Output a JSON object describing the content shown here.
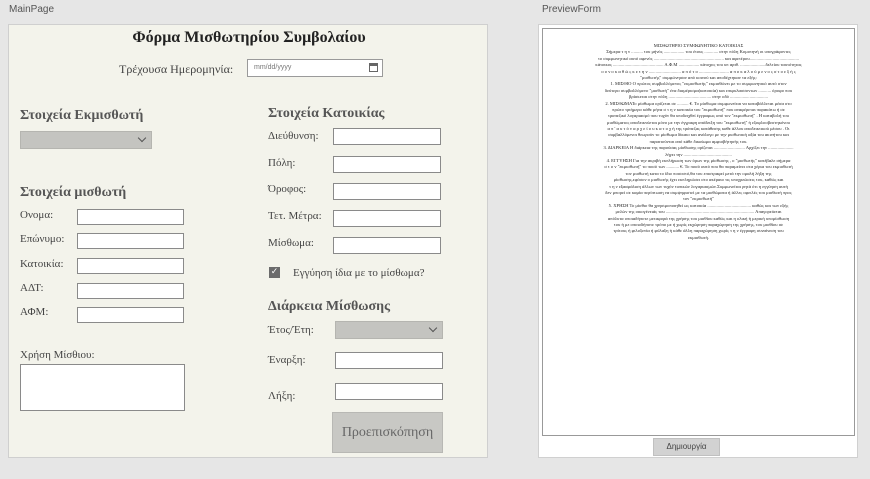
{
  "panes": {
    "main": "MainPage",
    "preview": "PreviewForm"
  },
  "form": {
    "title": "Φόρμα Μισθωτηρίου Συμβολαίου",
    "date_label": "Τρέχουσα Ημερομηνία:",
    "date_placeholder": "mm/dd/yyyy",
    "landlord_section": "Στοιχεία Εκμισθωτή",
    "tenant_section": "Στοιχεία μισθωτή",
    "tenant_fields": [
      "Ονομα:",
      "Επώνυμο:",
      "Κατοικία:",
      "ΑΔΤ:",
      "ΑΦΜ:"
    ],
    "use_label": "Χρήση Μίσθιου:",
    "property_section": "Στοιχεία  Κατοικίας",
    "property_fields": [
      "Διεύθυνση:",
      "Πόλη:",
      "Όροφος:",
      "Τετ. Μέτρα:",
      "Μίσθωμα:"
    ],
    "guarantee_label": "Εγγύηση ίδια με το μίσθωμα?",
    "guarantee_checked": true,
    "duration_section": "Διάρκεια Μίσθωσης",
    "duration_fields": [
      "Έτος/Έτη:",
      "Έναρξη:",
      "Λήξη:"
    ],
    "preview_button": "Προεπισκόπηση"
  },
  "preview": {
    "create_button": "Δημιουργία",
    "lines": [
      "ΜΙΣΘΩΤΗΡΙΟ ΣΥΜΦΩΝΗΤΙΚΟ ΚΑΤΟΙΚΙΑΣ",
      "Σήμερα τ η ν .......... του μήνός .................. του έτους ............ στην πόλη Κομοτηνή οι υπογράφοντες",
      "το συμφωνητικό αυτό αφενός ............................................................. και αφετέρου...........................................",
      "κάτοικος ............................................ Α.Φ.Μ .................. κάτοχος του υπ αριθ. ......................δελτίου ταυτότητας",
      "ο ο ν ο κ α θ ώ ς κ ε τ η ν ............................ α π ό τ ο .......................... α π ο κ α λ ο ύ μ ε ν ο ς σ τ ο ε ξ ή ς",
      "\"μισθωτής\" συμφώνησαν από κοινού και αποδέχτηκαν τα εξής:",
      "1. ΜΙΣΘΙΟ Ο πρώτος συμβαλλόμενος \"εκμισθωτής\" εκμισθώνει με το συμφωνητικό αυτό στον",
      "δεύτερο συμβαλλόμενο \"μισθωτή\" ένα διαμέρισμα(κατοικία) και επιφυλασσοντων ........... όροφο που",
      "βρίσκεται στην πόλη ..................................... στην οδό .................................",
      "2. ΜΙΣΘΩΜΑΤο μίσθωμα ορίζεται σε .......... €. Το μίσθωμα συμφωνείται να καταβάλλεται μέσα στο",
      "πρώτο τριήμερο κάθε μήνα σ τ η ν κατοικία του \"εκμισθωτή\" που αναφέρεται παρακάτω ή σε",
      "τραπεζικό λογαριασμό που τυχόν θα υποδειχθεί έγγραφως από τον \"εκμισθωτή\" . Η καταβολή του",
      "μισθώματος αποδεικνύεται μόνο με την έγγραφη απόδειξη του \"εκμισθωτή\" ή εξοφλοσβεστηκόνου",
      "α π ' α υ τ ό ν α ρ χ ε ί ο υ κ α τ ο χ ή της τράπεζας κατάθεσης καθε άλλου αποδεικτικού μέσου . Οι",
      "συμβαλλόμενοι θεωρούν το μίσθωμα δίκαιο και ανάλογο με την μισθωτική αξία του ακινήτου και",
      "παραιτούνται από κάθε δικαίωμα αμφισβήτησής του.",
      "3. ΔΙΑΡΚΕΙΑ Η διάρκεια της παρούσας μίσθωσης ορίζεται ........................... Αρχίζει την ......................",
      "λήγει την ..........................................",
      "4. ΕΓΓΥΗΣΗ Για την ακριβή εκπλήρωση των όρων της μίσθωσης , ο \"μισθωτής\" κατέβαλε σήμερα",
      "σ τ ο ν \"εκμισθωτή\" το ποσό των ........... €. Το ποσό αυτό που θα παραμείνει στα χέρια του εκμισθωτή",
      "τον μισθωτή κατα το ίδιο ποσοστό,θα του επιστραφεί μετά την ομαλή λήξη της",
      "μίσθωσης,εφόσον ο μισθωτής έχει εκπληρώσει στο ακέραιο τις υποχρεώσεις του, καθώς και",
      "τ η ν εξασφάλιση άλλων των τυχόν τυπικών λογαριασμών.Συμφωνείται ρητά ότι η εγγύηση αυτή",
      "δεν μπορεί σε καμία περίπτωση να συμψηφιστεί με τα μισθώματα ή άλλες οφειλές του μισθωτή προς",
      "τον \"εκμισθωτή\"",
      "5. ΧΡΗΣΗ Το μίσθιο θα χρησιμοποιηθεί ως κατοικία ...................................... καθώς και των εξής",
      "μελών της οικογένειάς του ............................................................................. Απαγορεύεται",
      "απόλυτα οποιαδήποτε μεταφορά της χρήσης του μισθίου καθώς και η ολική ή μερική υπομίσθωση",
      "του ή με οποιοδήποτε τρόπο με ή χωρίς εκχώρηση παραχώρηση της χρήσης, του μισθίου σε",
      "τρίτους ή φιλοξενία ή φύλαξη ή κάθε άλλη παραχώρηση χωρίς τ η ν έγγραφη συναίνεση του",
      "εκμισθωτή."
    ]
  }
}
